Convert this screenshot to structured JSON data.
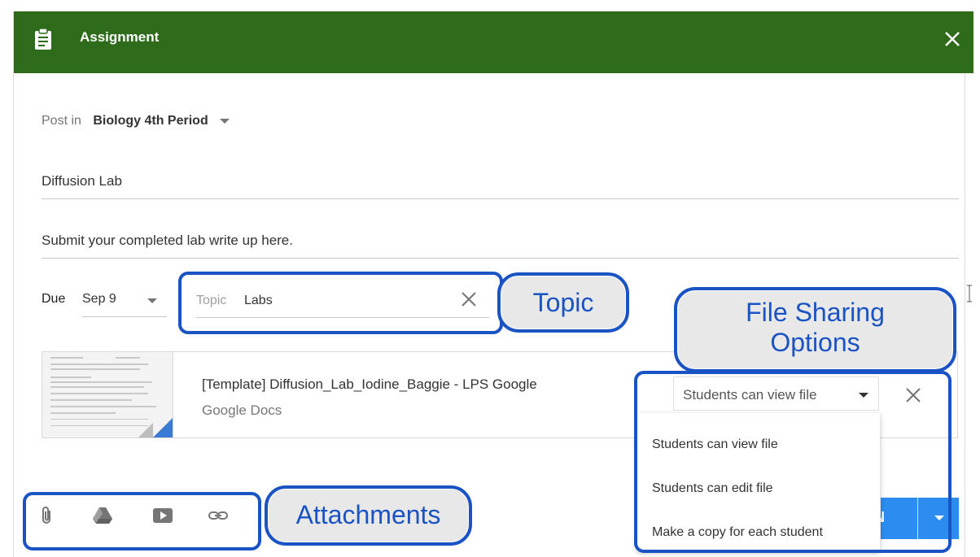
{
  "header": {
    "title": "Assignment",
    "icon": "clipboard-icon",
    "close_icon": "close-icon",
    "color": "#2e6b1a"
  },
  "post_in": {
    "label": "Post in",
    "value": "Biology 4th Period"
  },
  "title_field": {
    "value": "Diffusion Lab"
  },
  "description_field": {
    "value": "Submit your completed lab write up here."
  },
  "due": {
    "label": "Due",
    "value": "Sep 9"
  },
  "topic": {
    "label": "Topic",
    "value": "Labs"
  },
  "attachment": {
    "title": "[Template] Diffusion_Lab_Iodine_Baggie - LPS Google",
    "type": "Google Docs",
    "sharing": "Students can view file"
  },
  "sharing_menu": {
    "items": [
      "Students can view file",
      "Students can edit file",
      "Make a copy for each student"
    ]
  },
  "assign_button": {
    "label_fragment": "N",
    "color": "#2d8cf0"
  },
  "attach_icons": [
    "paperclip-icon",
    "google-drive-icon",
    "youtube-icon",
    "link-icon"
  ],
  "callouts": {
    "topic": "Topic",
    "file_sharing_line1": "File Sharing",
    "file_sharing_line2": "Options",
    "attachments": "Attachments",
    "color": "#1a53c4"
  }
}
